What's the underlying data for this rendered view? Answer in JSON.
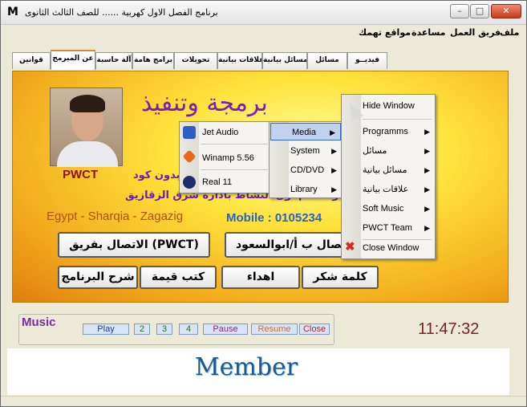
{
  "window": {
    "icon_letter": "M",
    "title": "برنامج الفصل الاول كهربية ...... للصف الثالث الثانوى",
    "btn_min": "–",
    "btn_max": "□",
    "btn_close": "✕"
  },
  "menubar": {
    "items": [
      "ملف",
      "فريق العمل",
      "مساعدة",
      "مواقع تهمك"
    ]
  },
  "tabs": [
    "فيديــو",
    "مسائل",
    "مسائل بيانية",
    "علاقات بيانية",
    "تحويلات",
    "برامج هامة",
    "آلة حاسبة",
    "عن المبرمج",
    "قوانين"
  ],
  "panel": {
    "heading": "برمجة وتنفيذ",
    "photo_name": "PWCT",
    "line1": "بدون كود",
    "line2": "أ/ أبو السعود معلم أول النشاط بادارة شرق الزقازيق",
    "location": "Egypt - Sharqia - Zagazig",
    "mobile": "Mobile : 0105234",
    "buttons": {
      "contact_team": "الاتصال بفريق (PWCT)",
      "contact_author": "اتصال ب أ/ابوالسعود",
      "explain": "شرح البرنامج",
      "books": "كتب قيمة",
      "gifts": "اهداء",
      "thanks": "كلمة شكر"
    }
  },
  "context_menu": {
    "items": [
      {
        "label": "Hide Window",
        "arrow": false
      },
      {
        "label": "Programms",
        "arrow": true
      },
      {
        "label": "مسائل",
        "arrow": true
      },
      {
        "label": "مسائل بيانية",
        "arrow": true
      },
      {
        "label": "علاقات بيانية",
        "arrow": true
      },
      {
        "label": "Soft Music",
        "arrow": true
      },
      {
        "label": "PWCT Team",
        "arrow": true
      },
      {
        "label": "Close Window",
        "arrow": false
      }
    ],
    "arrow_glyph": "▶"
  },
  "programs_submenu": {
    "items": [
      {
        "label": "Media",
        "arrow": true,
        "highlighted": true
      },
      {
        "label": "System",
        "arrow": true
      },
      {
        "label": "CD/DVD",
        "arrow": true
      },
      {
        "label": "Library",
        "arrow": true
      }
    ]
  },
  "media_submenu": {
    "items": [
      {
        "label": "Jet Audio",
        "icon": "jet-audio-icon",
        "color": "#2f5fc4"
      },
      {
        "label": "Winamp 5.56",
        "icon": "winamp-icon",
        "color": "#e8681a"
      },
      {
        "label": "Real 11",
        "icon": "real-player-icon",
        "color": "#1d2f6b"
      }
    ]
  },
  "music": {
    "label": "Music",
    "buttons": [
      "Play",
      "2",
      "3",
      "4",
      "Pause",
      "Resume",
      "Close"
    ],
    "time": "11:47:32"
  },
  "footer": {
    "text": "Member"
  },
  "colors": {
    "heading": "#7a1fb4",
    "location": "#b04e0b",
    "mobile": "#2a5fd0",
    "clock": "#7a2323",
    "member": "#1a5a94"
  }
}
